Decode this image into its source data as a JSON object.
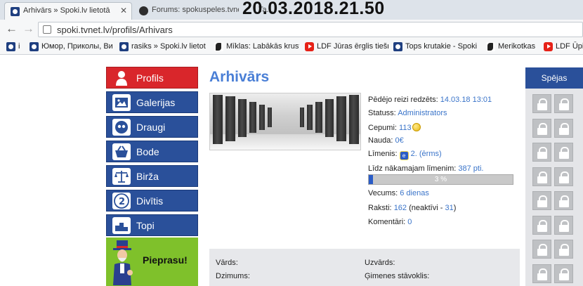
{
  "browser": {
    "tabs": [
      {
        "title": "Arhivārs » Spoki.lv lietotā",
        "active": true
      },
      {
        "title": "Forums: spokuspeles.tvne",
        "active": false
      },
      {
        "title": "Ta...",
        "active": false
      }
    ],
    "overlay_timestamp": "20.03.2018.21.50",
    "url": "spoki.tvnet.lv/profils/Arhivars",
    "bookmarks": [
      {
        "label": "i",
        "icon": "spoki-icon"
      },
      {
        "label": "Юмор, Приколы, Ви",
        "icon": "spoki-icon"
      },
      {
        "label": "rasiks » Spoki.lv lietot",
        "icon": "spoki-icon"
      },
      {
        "label": "Mīklas: Labākās krust",
        "icon": "merikotkas-icon"
      },
      {
        "label": "LDF Jūras ērglis tiešrā",
        "icon": "youtube-icon"
      },
      {
        "label": "Tops krutakie - Spoki",
        "icon": "spoki-icon"
      },
      {
        "label": "Merikotkas",
        "icon": "merikotkas-icon"
      },
      {
        "label": "LDF Ūpis",
        "icon": "youtube-icon"
      }
    ]
  },
  "nav": {
    "items": [
      {
        "label": "Profils",
        "icon": "user-icon",
        "active": true
      },
      {
        "label": "Galerijas",
        "icon": "gallery-icon",
        "active": false
      },
      {
        "label": "Draugi",
        "icon": "friends-icon",
        "active": false
      },
      {
        "label": "Bode",
        "icon": "basket-icon",
        "active": false
      },
      {
        "label": "Birža",
        "icon": "scales-icon",
        "active": false
      },
      {
        "label": "Divītis",
        "icon": "two-euro-icon",
        "active": false
      },
      {
        "label": "Topi",
        "icon": "podium-icon",
        "active": false
      }
    ],
    "banner_text": "Pieprasu!"
  },
  "profile": {
    "username": "Arhivārs",
    "last_seen_label": "Pēdējo reizi redzēts:",
    "last_seen_value": "14.03.18 13:01",
    "status_label": "Statuss:",
    "status_value": "Administrators",
    "cookies_label": "Cepumi:",
    "cookies_value": "113",
    "money_label": "Nauda:",
    "money_value": "0€",
    "level_label": "Līmenis:",
    "level_value": "2. (ērms)",
    "next_level_label": "Līdz nākamajam līmenim:",
    "next_level_value": "387 pti.",
    "level_progress_text": "3 %",
    "level_progress": 0.03,
    "age_label": "Vecums:",
    "age_value": "6 dienas",
    "posts_label": "Raksti:",
    "posts_value": "162",
    "posts_inactive_prefix": "(neaktīvi - ",
    "posts_inactive_value": "31",
    "posts_inactive_suffix": ")",
    "comments_label": "Komentāri:",
    "comments_value": "0"
  },
  "details": {
    "name_label": "Vārds:",
    "surname_label": "Uzvārds:",
    "birth_label": "Dzimums:",
    "family_label": "Ģimenes stāvoklis:"
  },
  "skills": {
    "title": "Spējas",
    "locked_count": 16
  },
  "colors": {
    "accent_blue": "#2a509a",
    "active_red": "#d9262b",
    "link_blue": "#3a74c9",
    "banner_green": "#7fc12b"
  }
}
